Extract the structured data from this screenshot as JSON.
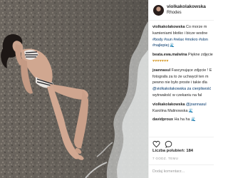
{
  "post": {
    "username": "violkakolakowska",
    "location": "Rhodes"
  },
  "comments": [
    {
      "user": "violkakolakowska",
      "lines": [
        "Co morze m",
        "kamieniami błotko i bicze wodne",
        "#body #sun #relax #mokro #slon",
        "#najlepiej 🌊"
      ]
    },
    {
      "user": "beata.ewa.malwina",
      "lines": [
        "Piękne zdjęcie",
        "♥♥♥♥♥♥♥"
      ]
    },
    {
      "user": "joannasul",
      "lines": [
        "Fascynujące zdjęcie ! E",
        "fotografa za to że uchwycił ten m",
        "pewno nie było proste i takie dla",
        "@violkakolakowska za cierpliwość",
        "wytrwałość w czekaniu na fal"
      ]
    },
    {
      "user": "violkakolakowska",
      "lines": [
        "@joannasul",
        "Karolina Malinowska 🌊"
      ]
    },
    {
      "user": "davidproux",
      "lines": [
        "Ha ha ha 🌊"
      ]
    }
  ],
  "actions": {
    "like_icon": "heart-icon",
    "comment_icon": "comment-icon"
  },
  "likes_text": "Liczba polubień: 184",
  "date_text": "7 GODZ. TEMU",
  "add_comment_placeholder": "Dodaj komentarz..."
}
